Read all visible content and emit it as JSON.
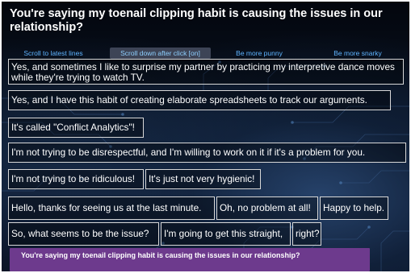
{
  "header": {
    "title": "You're saying my toenail clipping habit is causing the issues in our relationship?"
  },
  "tabs": [
    {
      "label": "Scroll to latest lines"
    },
    {
      "label": "Scroll down after click [on]"
    },
    {
      "label": "Be more punny"
    },
    {
      "label": "Be more snarky"
    }
  ],
  "messages": [
    {
      "text": "Yes, and sometimes I like to surprise my partner by practicing my interpretive dance moves while they're trying to watch TV."
    },
    {
      "text": "Yes, and I have this habit of creating elaborate spreadsheets to track our arguments."
    },
    {
      "text": "It's called \"Conflict Analytics\"!"
    },
    {
      "text": "I'm not trying to be disrespectful, and I'm willing to work on it if it's a problem for you."
    },
    {
      "text": "I'm not trying to be ridiculous!"
    },
    {
      "text": "It's just not very hygienic!"
    },
    {
      "text": "Hello, thanks for seeing us at the last minute."
    },
    {
      "text": "Oh, no problem at all!"
    },
    {
      "text": "Happy to help."
    },
    {
      "text": "So, what seems to be the issue?"
    },
    {
      "text": "I'm going to get this straight,"
    },
    {
      "text": "right?"
    }
  ],
  "input": {
    "text": "You're saying my toenail clipping habit is causing the issues in our relationship?"
  },
  "colors": {
    "background": "#0b1528",
    "tab_text": "#5fb4ff",
    "active_tab_bg": "#3d4456",
    "input_bar": "#6d3a8d",
    "bubble_border": "#d8d8d8"
  }
}
